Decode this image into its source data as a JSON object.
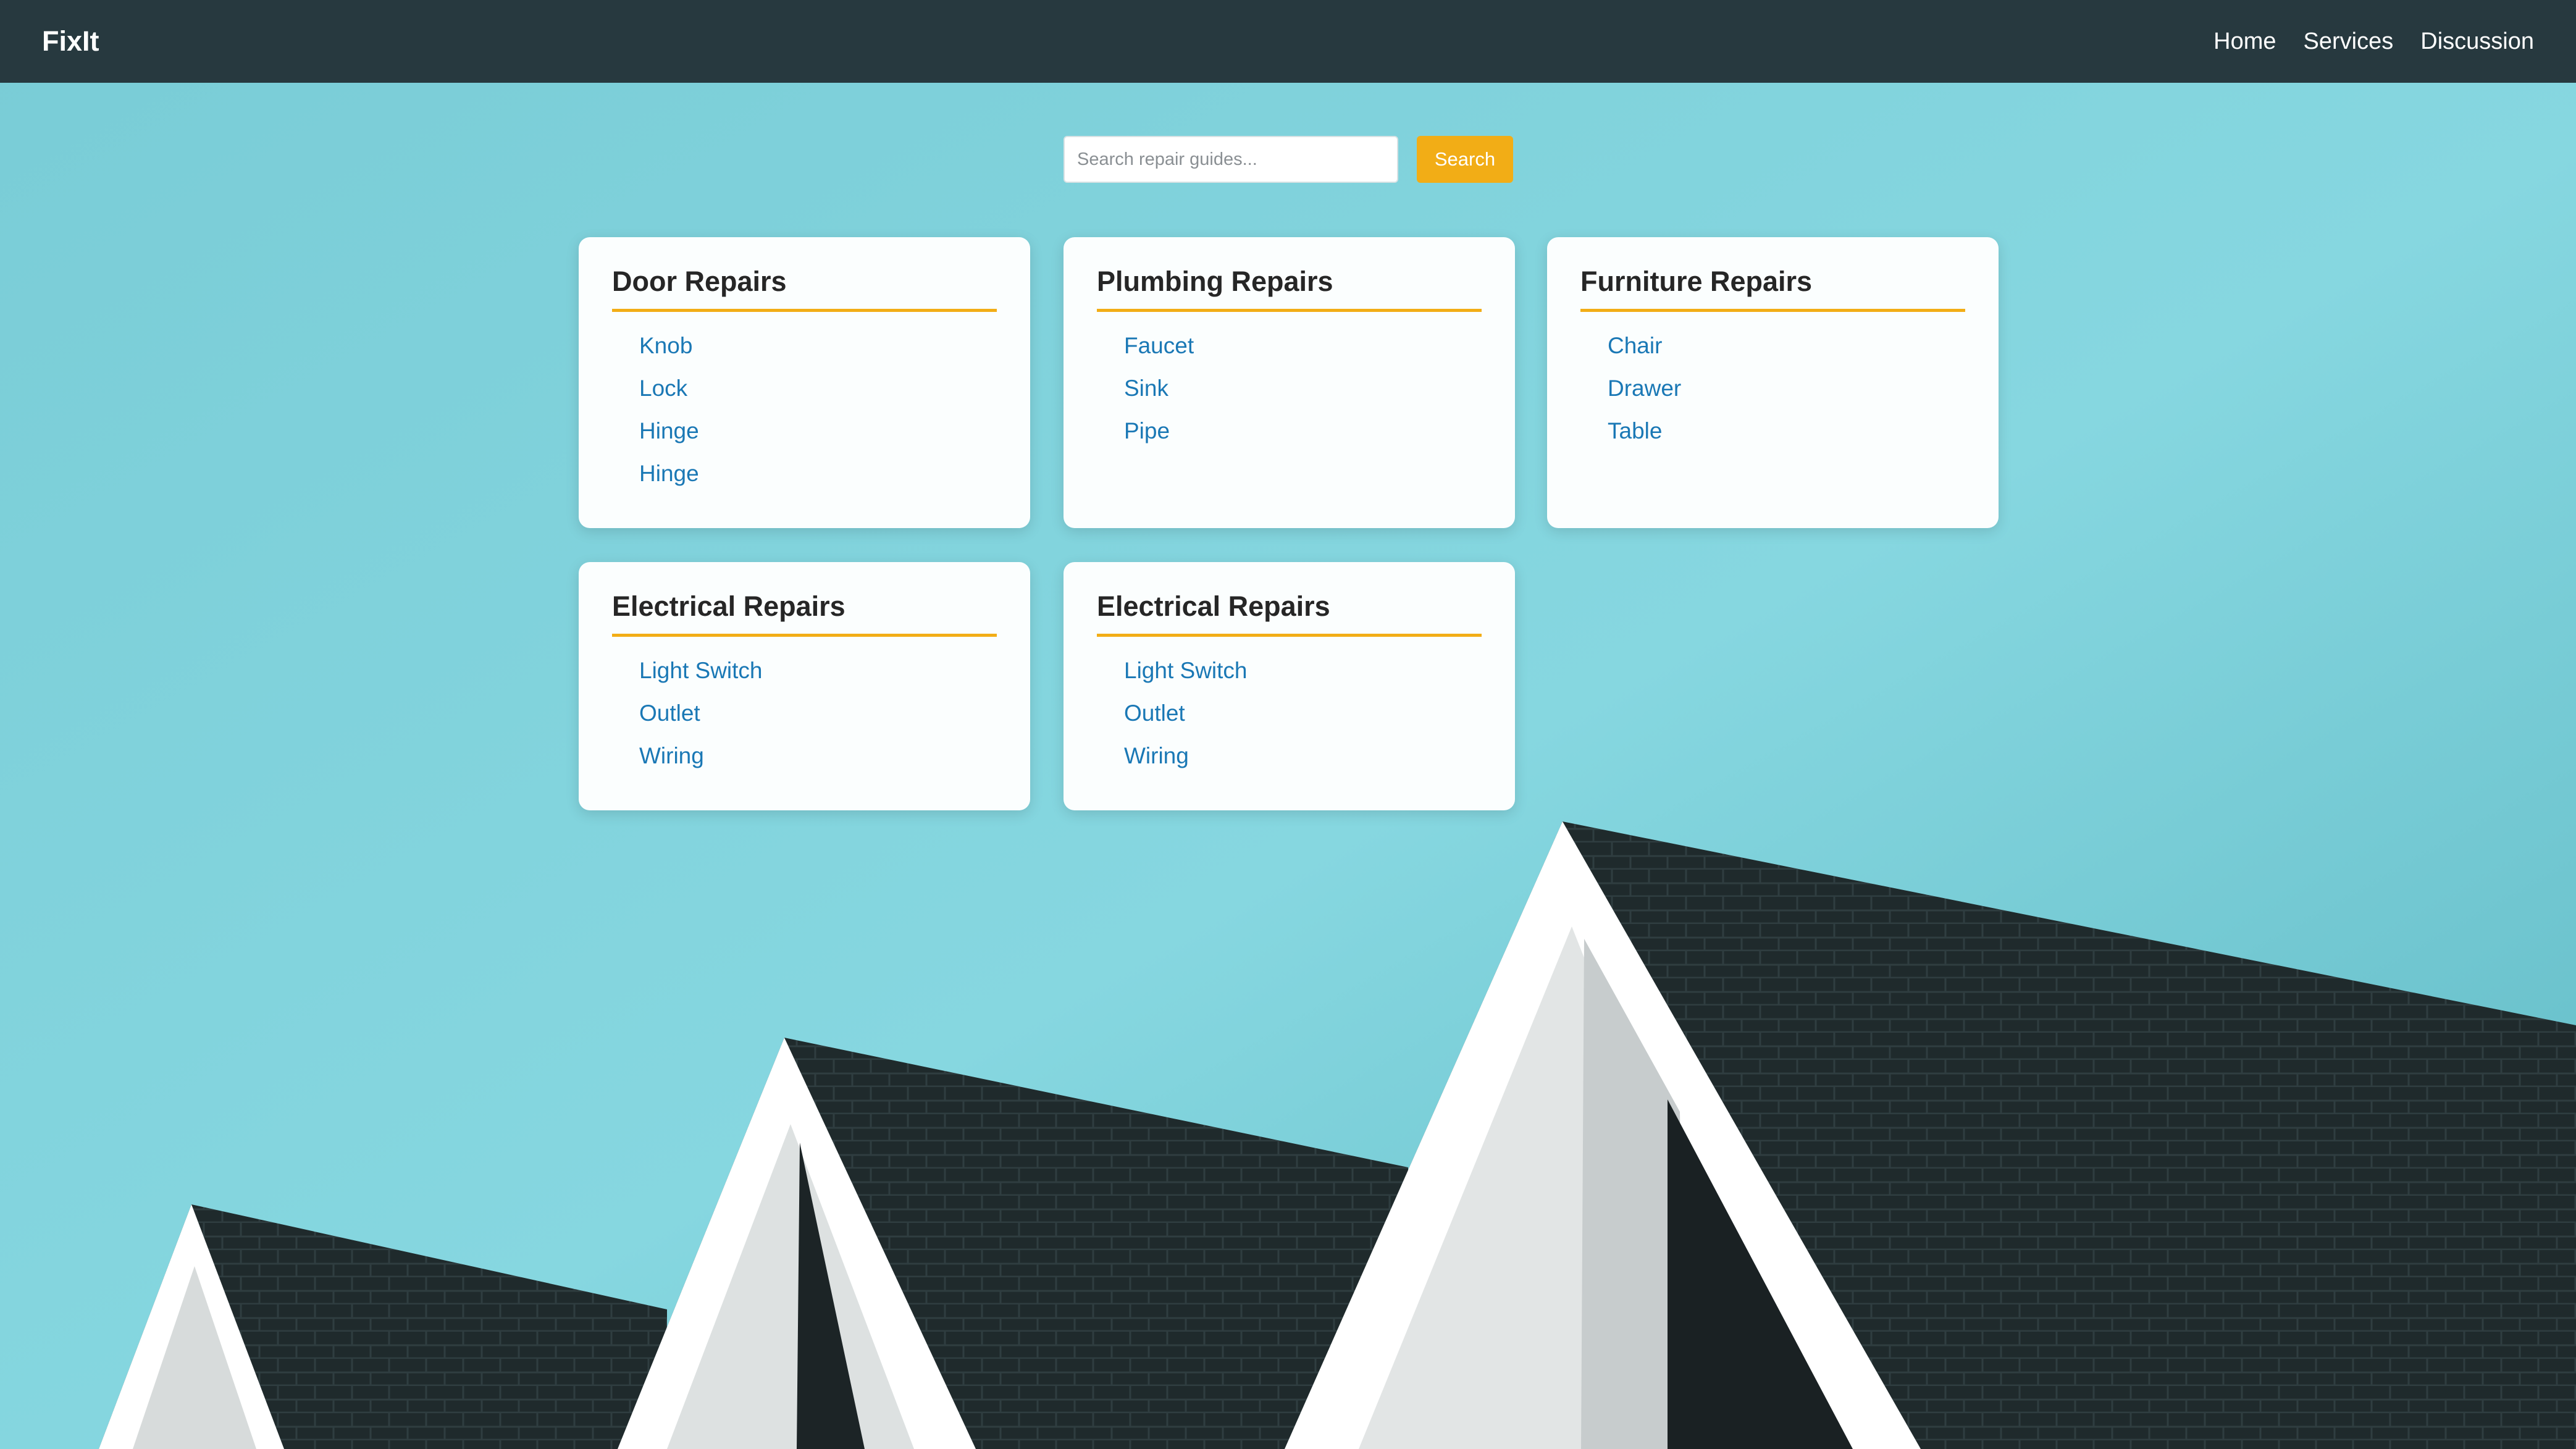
{
  "brand": "FixIt",
  "nav": [
    {
      "label": "Home"
    },
    {
      "label": "Services"
    },
    {
      "label": "Discussion"
    }
  ],
  "search": {
    "placeholder": "Search repair guides...",
    "value": "",
    "button_label": "Search"
  },
  "categories": [
    {
      "title": "Door Repairs",
      "items": [
        "Knob",
        "Lock",
        "Hinge",
        "Hinge"
      ]
    },
    {
      "title": "Plumbing Repairs",
      "items": [
        "Faucet",
        "Sink",
        "Pipe"
      ]
    },
    {
      "title": "Furniture Repairs",
      "items": [
        "Chair",
        "Drawer",
        "Table"
      ]
    },
    {
      "title": "Electrical Repairs",
      "items": [
        "Light Switch",
        "Outlet",
        "Wiring"
      ]
    },
    {
      "title": "Electrical Repairs",
      "items": [
        "Light Switch",
        "Outlet",
        "Wiring"
      ]
    }
  ],
  "colors": {
    "navbar": "#27393f",
    "accent": "#f2ad16",
    "link": "#1a78b5",
    "sky": "#7fd3dc",
    "roof": "#1f2a2c"
  }
}
